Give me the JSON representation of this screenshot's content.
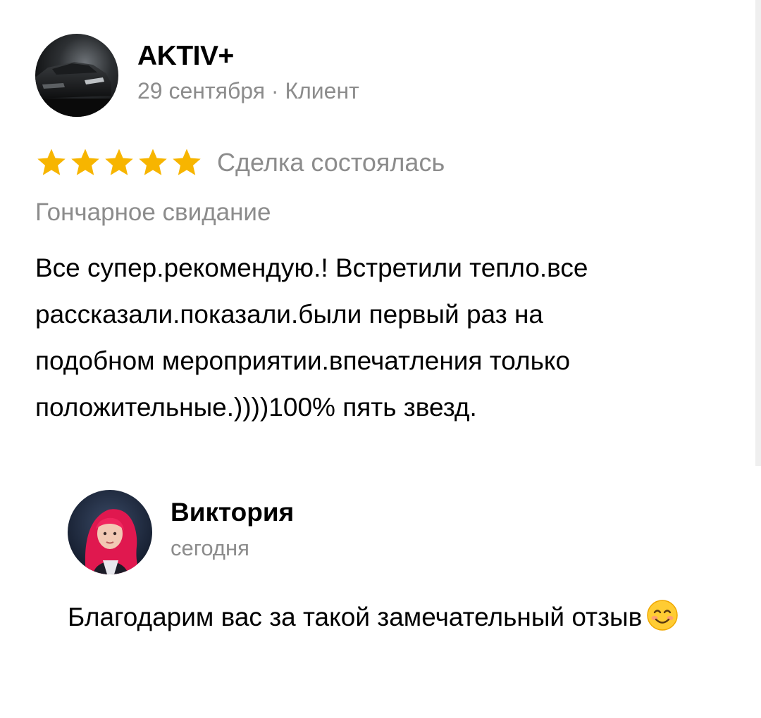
{
  "review": {
    "author": {
      "name": "AKTIV+",
      "date": "29 сентября",
      "separator": " · ",
      "role": "Клиент",
      "avatar_icon": "car-avatar"
    },
    "rating": {
      "stars": 5,
      "max_stars": 5,
      "star_color": "#f7b500",
      "status": "Сделка состоялась"
    },
    "service": "Гончарное свидание",
    "text": "Все супер.рекомендую.! Встретили тепло.все рассказали.показали.были первый раз на подобном мероприятии.впечатления только положительные.))))100% пять звезд."
  },
  "reply": {
    "author": {
      "name": "Виктория",
      "date": "сегодня",
      "avatar_icon": "person-avatar"
    },
    "text": "Благодарим вас за такой замечательный отзыв",
    "emoji_icon": "smiling-face-emoji"
  },
  "colors": {
    "text_primary": "#000000",
    "text_secondary": "#8c8c8c",
    "background": "#ffffff"
  }
}
